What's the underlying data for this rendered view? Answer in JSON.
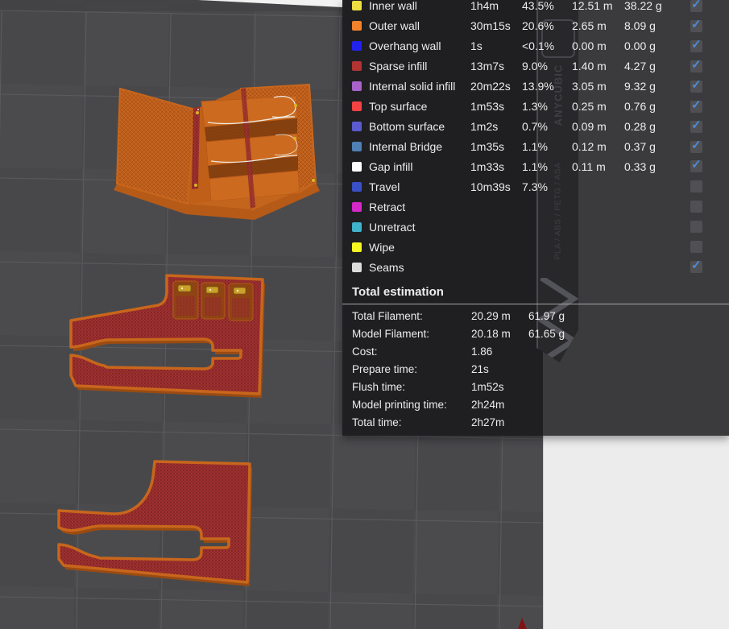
{
  "legend": {
    "rows": [
      {
        "label": "Inner wall",
        "color": "#EFDE41",
        "time": "1h4m",
        "percent": "43.5%",
        "length": "12.51 m",
        "weight": "38.22 g",
        "checked": true
      },
      {
        "label": "Outer wall",
        "color": "#F4822B",
        "time": "30m15s",
        "percent": "20.6%",
        "length": "2.65 m",
        "weight": "8.09 g",
        "checked": true
      },
      {
        "label": "Overhang wall",
        "color": "#2222F0",
        "time": "1s",
        "percent": "<0.1%",
        "length": "0.00 m",
        "weight": "0.00 g",
        "checked": true
      },
      {
        "label": "Sparse infill",
        "color": "#B13433",
        "time": "13m7s",
        "percent": "9.0%",
        "length": "1.40 m",
        "weight": "4.27 g",
        "checked": true
      },
      {
        "label": "Internal solid infill",
        "color": "#A763C9",
        "time": "20m22s",
        "percent": "13.9%",
        "length": "3.05 m",
        "weight": "9.32 g",
        "checked": true
      },
      {
        "label": "Top surface",
        "color": "#F44342",
        "time": "1m53s",
        "percent": "1.3%",
        "length": "0.25 m",
        "weight": "0.76 g",
        "checked": true
      },
      {
        "label": "Bottom surface",
        "color": "#5B5BD0",
        "time": "1m2s",
        "percent": "0.7%",
        "length": "0.09 m",
        "weight": "0.28 g",
        "checked": true
      },
      {
        "label": "Internal Bridge",
        "color": "#4E80B4",
        "time": "1m35s",
        "percent": "1.1%",
        "length": "0.12 m",
        "weight": "0.37 g",
        "checked": true
      },
      {
        "label": "Gap infill",
        "color": "#FFFFFF",
        "time": "1m33s",
        "percent": "1.1%",
        "length": "0.11 m",
        "weight": "0.33 g",
        "checked": true
      },
      {
        "label": "Travel",
        "color": "#3A50C8",
        "time": "10m39s",
        "percent": "7.3%",
        "length": "",
        "weight": "",
        "checked": false
      },
      {
        "label": "Retract",
        "color": "#D428C8",
        "time": "",
        "percent": "",
        "length": "",
        "weight": "",
        "checked": false
      },
      {
        "label": "Unretract",
        "color": "#3FB2CC",
        "time": "",
        "percent": "",
        "length": "",
        "weight": "",
        "checked": false
      },
      {
        "label": "Wipe",
        "color": "#F6F620",
        "time": "",
        "percent": "",
        "length": "",
        "weight": "",
        "checked": false
      },
      {
        "label": "Seams",
        "color": "#DCDCDC",
        "time": "",
        "percent": "",
        "length": "",
        "weight": "",
        "checked": true
      }
    ]
  },
  "totals": {
    "title": "Total estimation",
    "rows": [
      {
        "label": "Total Filament:",
        "value": "20.29 m",
        "value2": "61.97 g"
      },
      {
        "label": "Model Filament:",
        "value": "20.18 m",
        "value2": "61.65 g"
      },
      {
        "label": "Cost:",
        "value": "1.86",
        "value2": ""
      },
      {
        "label": "Prepare time:",
        "value": "21s",
        "value2": ""
      },
      {
        "label": "Flush time:",
        "value": "1m52s",
        "value2": ""
      },
      {
        "label": "Model printing time:",
        "value": "2h24m",
        "value2": ""
      },
      {
        "label": "Total time:",
        "value": "2h27m",
        "value2": ""
      }
    ]
  },
  "spool": {
    "brand": "ANYCUBIC",
    "materials": "PLA / ABS / PETG / ASA"
  },
  "icons": {
    "check": "✓"
  },
  "colors": {
    "checkbox_check": "#4C8BD8",
    "panel_left": "#1F1F22",
    "panel_right": "#3B3B3E",
    "model_wall_orange": "#C8661C",
    "model_surface_red": "#A33131",
    "viewport_bg": "#4B4B4E",
    "sidebar_bg": "#ECECED"
  }
}
